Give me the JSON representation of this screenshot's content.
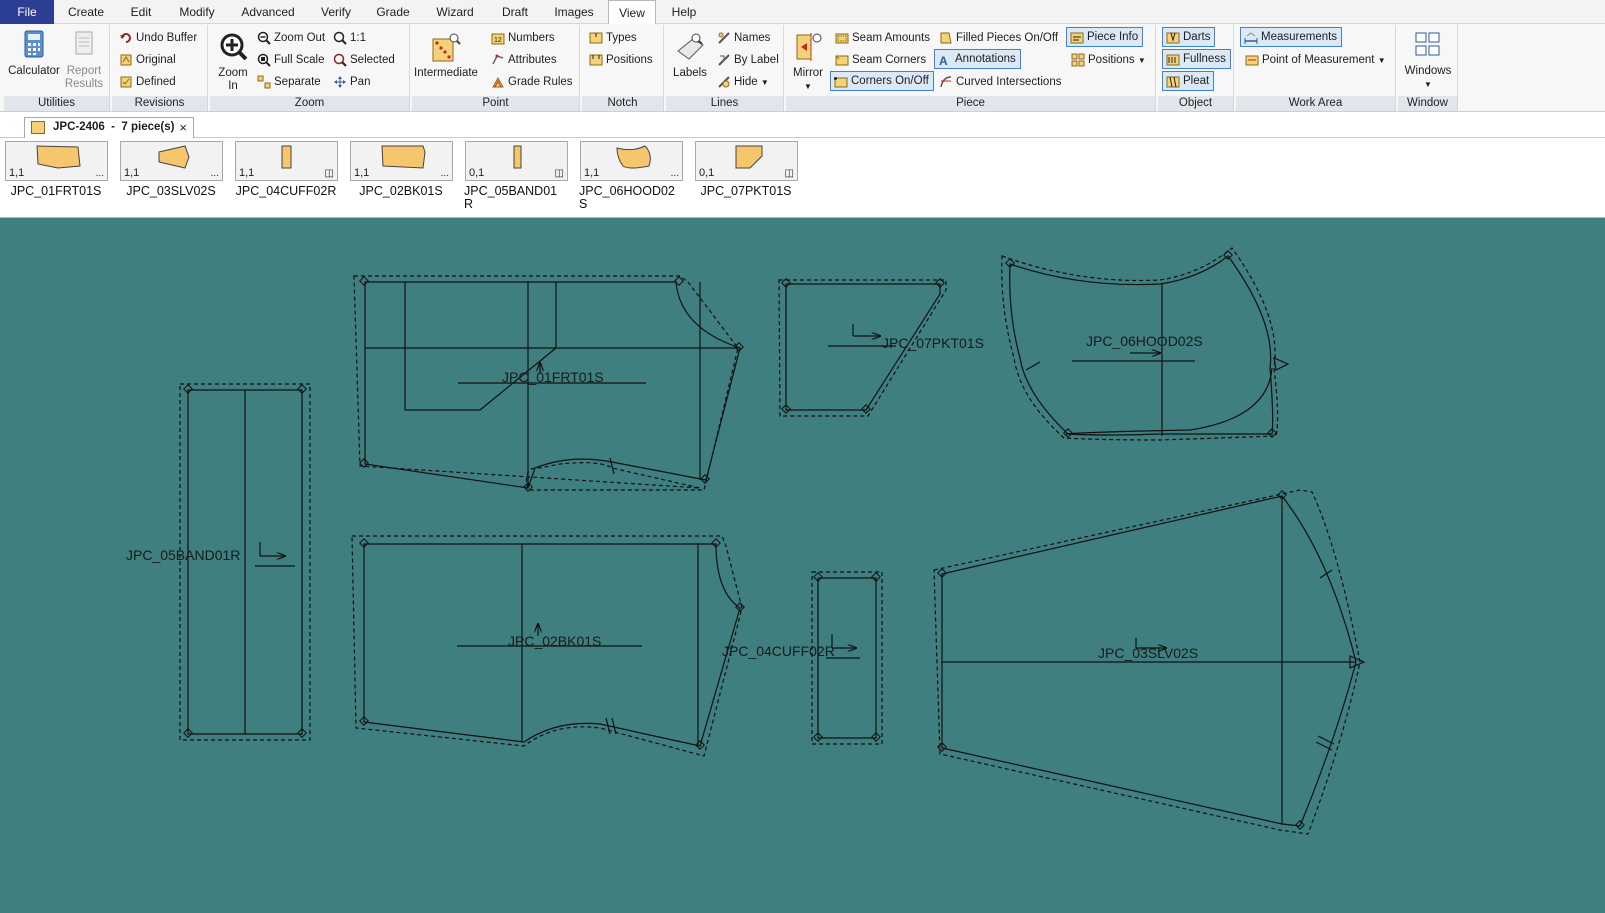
{
  "menu": {
    "file": "File",
    "create": "Create",
    "edit": "Edit",
    "modify": "Modify",
    "advanced": "Advanced",
    "verify": "Verify",
    "grade": "Grade",
    "wizard": "Wizard",
    "draft": "Draft",
    "images": "Images",
    "view": "View",
    "help": "Help",
    "active": "View"
  },
  "ribbon": {
    "utilities": {
      "label": "Utilities",
      "calculator": "Calculator",
      "report_results_1": "Report",
      "report_results_2": "Results"
    },
    "revisions": {
      "label": "Revisions",
      "undo_buffer": "Undo Buffer",
      "original": "Original",
      "defined": "Defined"
    },
    "zoom": {
      "label": "Zoom",
      "zoom_in_1": "Zoom",
      "zoom_in_2": "In",
      "zoom_out": "Zoom Out",
      "full_scale": "Full Scale",
      "separate": "Separate",
      "one_to_one": "1:1",
      "selected": "Selected",
      "pan": "Pan"
    },
    "point": {
      "label": "Point",
      "intermediate": "Intermediate",
      "numbers": "Numbers",
      "attributes": "Attributes",
      "grade_rules": "Grade Rules"
    },
    "notch": {
      "label": "Notch",
      "types": "Types",
      "positions": "Positions"
    },
    "lines": {
      "label": "Lines",
      "labels": "Labels",
      "names": "Names",
      "by_label": "By Label",
      "hide": "Hide"
    },
    "piece": {
      "label": "Piece",
      "mirror": "Mirror",
      "seam_amounts": "Seam Amounts",
      "seam_corners": "Seam Corners",
      "corners_on_off": "Corners On/Off",
      "filled_pieces": "Filled Pieces On/Off",
      "annotations": "Annotations",
      "curved_intersections": "Curved Intersections",
      "piece_info": "Piece Info",
      "positions": "Positions"
    },
    "object": {
      "label": "Object",
      "darts": "Darts",
      "fullness": "Fullness",
      "pleat": "Pleat"
    },
    "work_area": {
      "label": "Work Area",
      "measurements": "Measurements",
      "point_of_measurement": "Point of Measurement"
    },
    "window": {
      "label": "Window",
      "windows": "Windows"
    }
  },
  "tab": {
    "title": "JPC-2406  -  7 piece(s)",
    "close": "×"
  },
  "thumbnails": [
    {
      "name": "JPC_01FRT01S",
      "num": "1,1",
      "mark": "..."
    },
    {
      "name": "JPC_03SLV02S",
      "num": "1,1",
      "mark": "..."
    },
    {
      "name": "JPC_04CUFF02R",
      "num": "1,1",
      "mark": "◫"
    },
    {
      "name": "JPC_02BK01S",
      "num": "1,1",
      "mark": "..."
    },
    {
      "name": "JPC_05BAND01R",
      "num": "0,1",
      "mark": "◫"
    },
    {
      "name": "JPC_06HOOD02S",
      "num": "1,1",
      "mark": "..."
    },
    {
      "name": "JPC_07PKT01S",
      "num": "0,1",
      "mark": "◫"
    }
  ],
  "pieces": {
    "front": "JPC_01FRT01S",
    "pocket": "JPC_07PKT01S",
    "hood": "JPC_06HOOD02S",
    "band": "JPC_05BAND01R",
    "back": "JPC_02BK01S",
    "cuff": "JPC_04CUFF02R",
    "sleeve": "JPC_03SLV02S"
  },
  "colors": {
    "workarea": "#3f7f7f",
    "piece_fill": "#f5c66b",
    "file_menu": "#2c3e94",
    "selected_outline": "#3f84c9"
  }
}
